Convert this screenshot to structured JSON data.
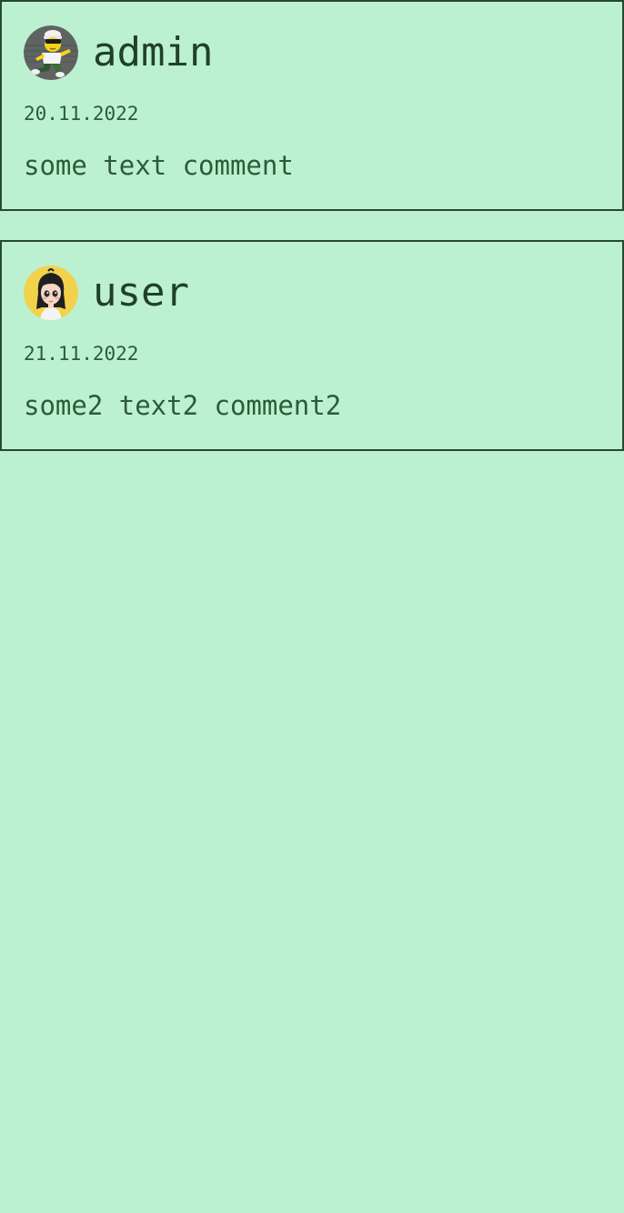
{
  "theme": {
    "background": "#bbf1d1",
    "border": "#264a2e",
    "text": "#2e5a38",
    "username_text": "#21402a"
  },
  "comments": [
    {
      "username": "admin",
      "date": "20.11.2022",
      "text": "some text comment",
      "avatar": "cartoon-character-with-cap-icon",
      "avatar_bg": "#5f6463"
    },
    {
      "username": "user",
      "date": "21.11.2022",
      "text": "some2 text2 comment2",
      "avatar": "cartoon-girl-icon",
      "avatar_bg": "#f2d24c"
    }
  ]
}
